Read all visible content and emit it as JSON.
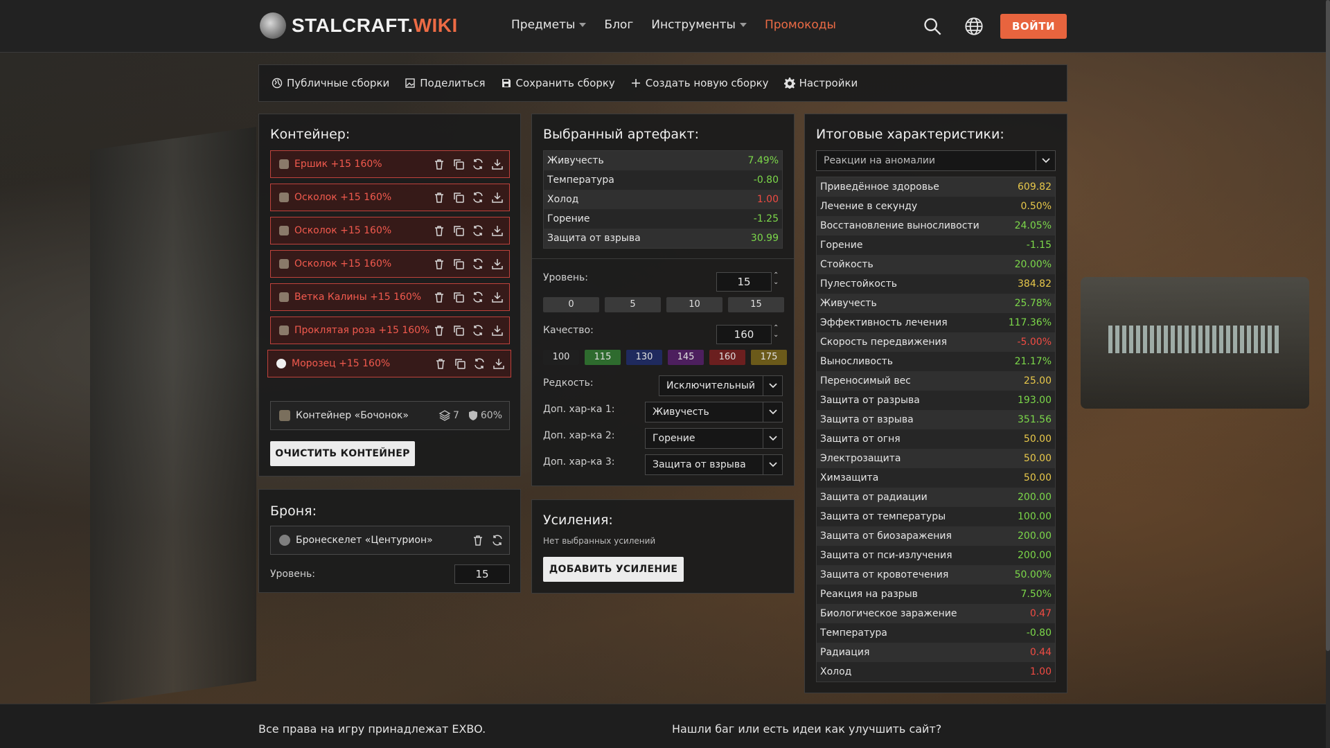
{
  "header": {
    "logo_main": "STALCRAFT.",
    "logo_accent": "WIKI",
    "nav": [
      {
        "label": "Предметы",
        "dropdown": true
      },
      {
        "label": "Блог",
        "dropdown": false
      },
      {
        "label": "Инструменты",
        "dropdown": true
      },
      {
        "label": "Промокоды",
        "dropdown": false
      }
    ],
    "login_label": "ВОЙТИ"
  },
  "toolbar": {
    "public": "Публичные сборки",
    "share": "Поделиться",
    "save": "Сохранить сборку",
    "create": "Создать новую сборку",
    "settings": "Настройки"
  },
  "container": {
    "title": "Контейнер:",
    "slots": [
      {
        "name": "Ершик +15 160%"
      },
      {
        "name": "Осколок +15 160%"
      },
      {
        "name": "Осколок +15 160%"
      },
      {
        "name": "Осколок +15 160%"
      },
      {
        "name": "Ветка Калины +15 160%"
      },
      {
        "name": "Проклятая роза +15 160%"
      },
      {
        "name": "Морозец +15 160%"
      }
    ],
    "container_name": "Контейнер «Бочонок»",
    "capacity": "7",
    "protection": "60%",
    "clear_label": "ОЧИСТИТЬ КОНТЕЙНЕР"
  },
  "armor": {
    "title": "Броня:",
    "name": "Бронескелет «Центурион»",
    "level_label": "Уровень:",
    "level_value": "15"
  },
  "artifact": {
    "title": "Выбранный артефакт:",
    "stats": [
      {
        "name": "Живучесть",
        "value": "7.49%",
        "tone": "pos"
      },
      {
        "name": "Температура",
        "value": "-0.80",
        "tone": "pos"
      },
      {
        "name": "Холод",
        "value": "1.00",
        "tone": "neg"
      },
      {
        "name": "Горение",
        "value": "-1.25",
        "tone": "pos"
      },
      {
        "name": "Защита от взрыва",
        "value": "30.99",
        "tone": "pos"
      }
    ],
    "level_label": "Уровень:",
    "level_value": "15",
    "level_chips": [
      "0",
      "5",
      "10",
      "15"
    ],
    "quality_label": "Качество:",
    "quality_value": "160",
    "quality_chips": [
      {
        "label": "100",
        "color": "#1f1f1f"
      },
      {
        "label": "115",
        "color": "#2e6b2e"
      },
      {
        "label": "130",
        "color": "#1f2a5e"
      },
      {
        "label": "145",
        "color": "#4d1f5e"
      },
      {
        "label": "160",
        "color": "#6b1f1f"
      },
      {
        "label": "175",
        "color": "#6b5a1a"
      }
    ],
    "rarity_label": "Редкость:",
    "rarity_value": "Исключительный",
    "extra1_label": "Доп. хар-ка 1:",
    "extra1_value": "Живучесть",
    "extra2_label": "Доп. хар-ка 2:",
    "extra2_value": "Горение",
    "extra3_label": "Доп. хар-ка 3:",
    "extra3_value": "Защита от взрыва"
  },
  "boosts": {
    "title": "Усиления:",
    "empty": "Нет выбранных усилений",
    "add_label": "ДОБАВИТЬ УСИЛЕНИЕ"
  },
  "totals": {
    "title": "Итоговые характеристики:",
    "filter": "Реакции на аномалии",
    "stats": [
      {
        "name": "Приведённое здоровье",
        "value": "609.82",
        "tone": "yel"
      },
      {
        "name": "Лечение в секунду",
        "value": "0.50%",
        "tone": "yel"
      },
      {
        "name": "Восстановление выносливости",
        "value": "24.05%",
        "tone": "pos"
      },
      {
        "name": "Горение",
        "value": "-1.15",
        "tone": "pos"
      },
      {
        "name": "Стойкость",
        "value": "20.00%",
        "tone": "pos"
      },
      {
        "name": "Пулестойкость",
        "value": "384.82",
        "tone": "yel"
      },
      {
        "name": "Живучесть",
        "value": "25.78%",
        "tone": "pos"
      },
      {
        "name": "Эффективность лечения",
        "value": "117.36%",
        "tone": "pos"
      },
      {
        "name": "Скорость передвижения",
        "value": "-5.00%",
        "tone": "neg"
      },
      {
        "name": "Выносливость",
        "value": "21.17%",
        "tone": "pos"
      },
      {
        "name": "Переносимый вес",
        "value": "25.00",
        "tone": "yel"
      },
      {
        "name": "Защита от разрыва",
        "value": "193.00",
        "tone": "pos"
      },
      {
        "name": "Защита от взрыва",
        "value": "351.56",
        "tone": "pos"
      },
      {
        "name": "Защита от огня",
        "value": "50.00",
        "tone": "yel"
      },
      {
        "name": "Электрозащита",
        "value": "50.00",
        "tone": "yel"
      },
      {
        "name": "Химзащита",
        "value": "50.00",
        "tone": "yel"
      },
      {
        "name": "Защита от радиации",
        "value": "200.00",
        "tone": "pos"
      },
      {
        "name": "Защита от температуры",
        "value": "100.00",
        "tone": "pos"
      },
      {
        "name": "Защита от биозаражения",
        "value": "200.00",
        "tone": "pos"
      },
      {
        "name": "Защита от пси-излучения",
        "value": "200.00",
        "tone": "pos"
      },
      {
        "name": "Защита от кровотечения",
        "value": "50.00%",
        "tone": "pos"
      },
      {
        "name": "Реакция на разрыв",
        "value": "7.50%",
        "tone": "pos"
      },
      {
        "name": "Биологическое заражение",
        "value": "0.47",
        "tone": "neg"
      },
      {
        "name": "Температура",
        "value": "-0.80",
        "tone": "pos"
      },
      {
        "name": "Радиация",
        "value": "0.44",
        "tone": "neg"
      },
      {
        "name": "Холод",
        "value": "1.00",
        "tone": "neg"
      }
    ]
  },
  "footer": {
    "rights": "Все права на игру принадлежат EXBO.",
    "feedback": "Нашли баг или есть идеи как улучшить сайт?"
  },
  "icons": {
    "trash": "trash-icon",
    "copy": "copy-icon",
    "swap": "swap-icon",
    "download": "download-icon",
    "search": "search-icon",
    "globe": "globe-icon"
  },
  "colors": {
    "accent": "#e8643e",
    "positive": "#7cd84a",
    "negative": "#f04b43",
    "neutral_value": "#e8c84a"
  }
}
